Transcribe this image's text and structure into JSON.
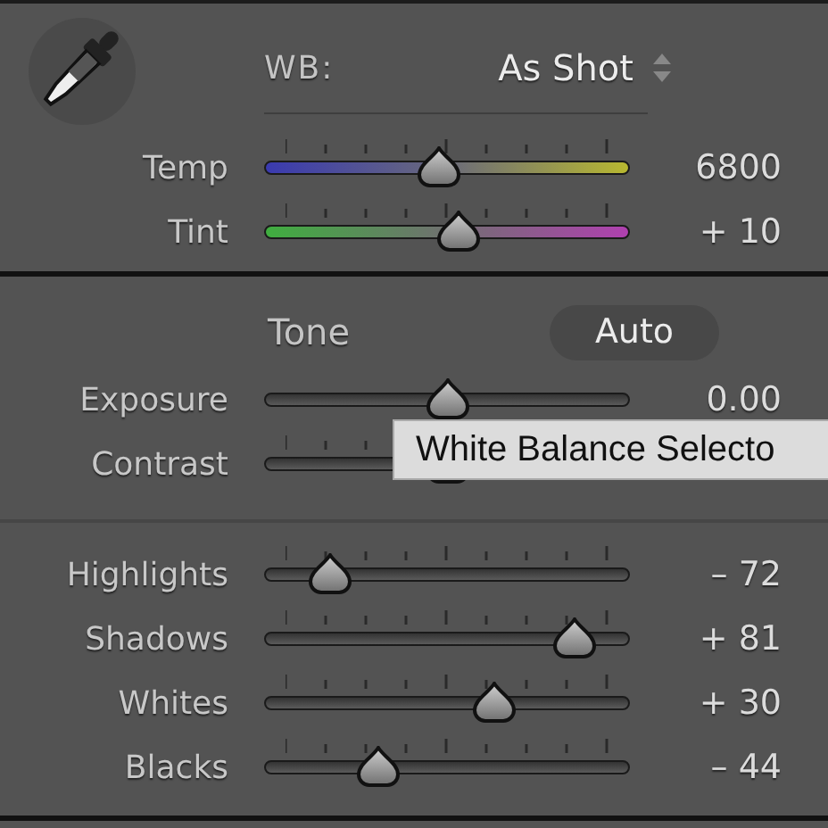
{
  "white_balance": {
    "label": "WB:",
    "value": "As Shot"
  },
  "wb_sliders": [
    {
      "label": "Temp",
      "value": "6800",
      "level": 0.48,
      "kind": "temp",
      "ticks": true
    },
    {
      "label": "Tint",
      "value": "+ 10",
      "level": 0.53,
      "kind": "tint",
      "ticks": true
    }
  ],
  "tone": {
    "title": "Tone",
    "auto_button": "Auto",
    "sliders": [
      {
        "label": "Exposure",
        "value": "0.00",
        "level": 0.5,
        "kind": "plain",
        "ticks": false
      },
      {
        "label": "Contrast",
        "level": 0.5,
        "kind": "plain",
        "ticks": true
      }
    ]
  },
  "presence_sliders": [
    {
      "label": "Highlights",
      "value": "– 72",
      "level": 0.18,
      "kind": "plain",
      "ticks": true
    },
    {
      "label": "Shadows",
      "value": "+ 81",
      "level": 0.85,
      "kind": "plain",
      "ticks": true
    },
    {
      "label": "Whites",
      "value": "+ 30",
      "level": 0.63,
      "kind": "plain",
      "ticks": true
    },
    {
      "label": "Blacks",
      "value": "– 44",
      "level": 0.31,
      "kind": "plain",
      "ticks": true
    }
  ],
  "tooltip": {
    "text": "White Balance Selecto"
  }
}
